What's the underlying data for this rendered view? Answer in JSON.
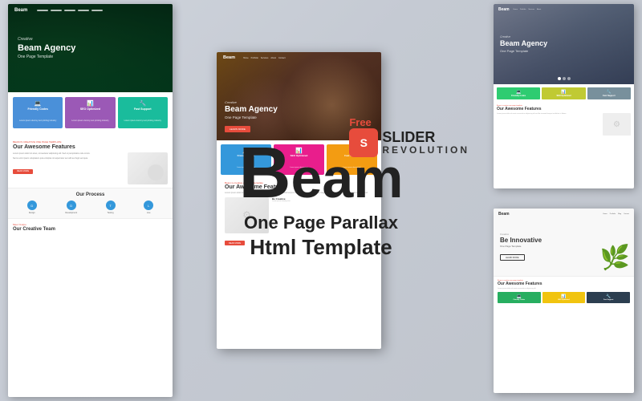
{
  "app": {
    "title": "Beam Agency - One Page Parallax Html Template"
  },
  "center_heading": {
    "letter_b": "B",
    "letters_eam": "eam",
    "line1": "One Page Parallax",
    "line2": "Html Template"
  },
  "badge": {
    "free_label": "Free",
    "icon_text": "S",
    "title": "SLIDER",
    "subtitle": "REVOLUTION"
  },
  "preview_left": {
    "logo": "Beam",
    "hero_eyebrow": "Creative",
    "hero_title": "Beam Agency",
    "hero_tagline": "One Page Template",
    "features": [
      {
        "color": "blue",
        "icon": "💻",
        "title": "Friendly Codes",
        "desc": "Lorem ipsum is simply dummy text printing industry"
      },
      {
        "color": "purple",
        "icon": "📊",
        "title": "SEO Optimized",
        "desc": "Lorem ipsum is simply dummy text printing industry"
      },
      {
        "color": "teal",
        "icon": "🔧",
        "title": "Fast Support",
        "desc": "Lorem ipsum is simply dummy text printing industry"
      }
    ],
    "awesome_label": "Beam is creative one page template",
    "awesome_title": "Our Awesome Features",
    "awesome_text": "Lorem ipsum dolor sit amet consectetur adipiscing elit sed do eiusmod tempor incididunt.",
    "process_title": "Our Process",
    "process_steps": [
      {
        "label": "Design",
        "desc": "Lorem ipsum"
      },
      {
        "label": "Development",
        "desc": "Lorem ipsum"
      },
      {
        "label": "Testing",
        "desc": "Lorem ipsum"
      },
      {
        "label": "Live",
        "desc": "Lorem ipsum"
      }
    ],
    "team_label": "Meet Yourpo",
    "team_title": "Our Creative Team"
  },
  "preview_center": {
    "logo": "Beam",
    "hero_eyebrow": "Creative",
    "hero_title": "Beam Agency",
    "hero_tagline": "One Page Template",
    "hero_cta": "LEARN MORE",
    "features": [
      {
        "color": "blue",
        "icon": "💻",
        "title": "Friendly Codes",
        "desc": "Lorem ipsum dummy text"
      },
      {
        "color": "pink",
        "icon": "📊",
        "title": "SEO Optimized",
        "desc": "Lorem ipsum dummy text"
      },
      {
        "color": "yellow",
        "icon": "🔧",
        "title": "Fast Support",
        "desc": "Lorem ipsum dummy text"
      }
    ],
    "awesome_title": "Our Awesome Features"
  },
  "preview_right_top": {
    "hero_eyebrow": "Creative",
    "hero_title": "Beam Agency",
    "hero_tagline": "One Page Template",
    "features": [
      {
        "color": "green",
        "icon": "💻",
        "title": "Friendly Codes"
      },
      {
        "color": "olive",
        "icon": "📊",
        "title": "SEO Optimized"
      },
      {
        "color": "gray",
        "icon": "🔧",
        "title": "Fast Support"
      }
    ],
    "awesome_label": "Beam is creative one page template",
    "awesome_title": "Our Awesome Features"
  },
  "preview_right_bottom": {
    "logo": "Beam",
    "hero_eyebrow": "Creative",
    "hero_title": "Be Innovative",
    "hero_tagline": "One Page Template",
    "hero_cta": "LEARN MORE",
    "awesome_label": "Beam is creative one page template",
    "awesome_title": "Our Awesome Features",
    "features": [
      {
        "color": "green",
        "icon": "💻",
        "title": "Codes"
      },
      {
        "color": "yellow",
        "icon": "📊",
        "title": "SEO"
      },
      {
        "color": "darkblue",
        "icon": "🔧",
        "title": "Support"
      }
    ]
  }
}
